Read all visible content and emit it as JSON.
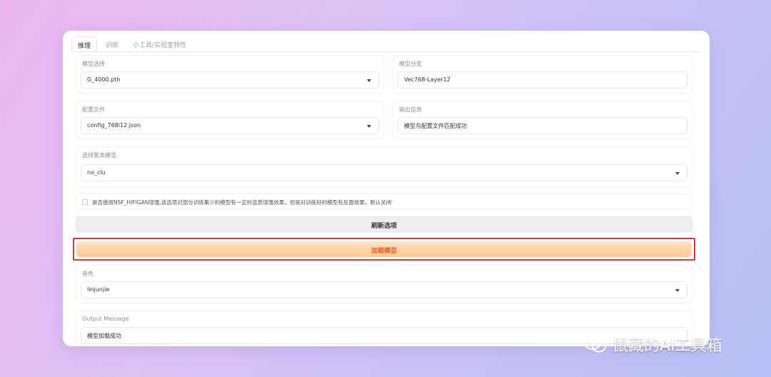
{
  "tabs": [
    {
      "label": "推理",
      "active": true
    },
    {
      "label": "训练",
      "active": false
    },
    {
      "label": "小工具/实验室特性",
      "active": false
    }
  ],
  "model_select": {
    "label": "模型选择",
    "value": "G_4000.pth"
  },
  "model_branch": {
    "label": "模型分支",
    "value": "Vec768-Layer12"
  },
  "config_file": {
    "label": "配置文件",
    "value": "config_768l12.json"
  },
  "output_info": {
    "label": "输出信息",
    "value": "模型与配置文件匹配成功"
  },
  "cluster_model": {
    "label": "选择聚类模型",
    "value": "no_clu"
  },
  "nsf_checkbox": {
    "label": "是否使用NSF_HIFIGAN增强,该选项对部分训练集少的模型有一定的音质增强效果，但是对训练好的模型有反面效果，默认关闭",
    "checked": false
  },
  "buttons": {
    "refresh": "刷新选项",
    "load_model": "加载模型"
  },
  "timbre": {
    "label": "音色",
    "value": "linjunjie"
  },
  "output_message": {
    "label": "Output Message",
    "value": "模型加载成功"
  },
  "watermark": {
    "text": "鼠藏的AI工具箱",
    "icon": "wechat-icon"
  },
  "colors": {
    "accent": "#e8611c",
    "highlight_border": "#d23a32",
    "load_bg": "#ffc892"
  }
}
